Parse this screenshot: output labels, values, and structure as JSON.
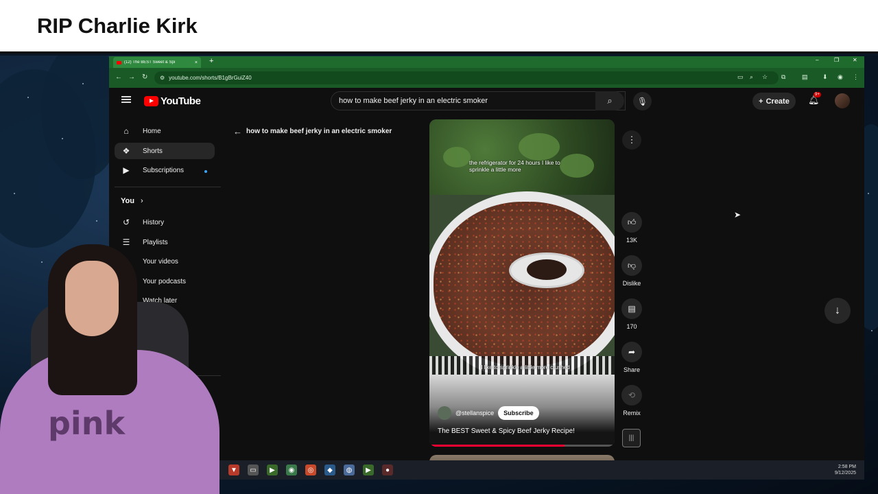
{
  "banner": {
    "title": "RIP Charlie Kirk"
  },
  "browser": {
    "tab_title": "(12) The BEST Sweet & Spi",
    "tab_close": "×",
    "new_tab": "+",
    "window_controls": [
      "–",
      "❐",
      "✕"
    ],
    "url": "youtube.com/shorts/B1gBrGuiZ40"
  },
  "youtube": {
    "logo_text": "YouTube",
    "search": {
      "value": "how to make beef jerky in an electric smoker",
      "clear": "✕"
    },
    "create_label": "Create",
    "notification_badge": "9+",
    "sidebar": {
      "items": [
        {
          "label": "Home",
          "icon": "home-icon"
        },
        {
          "label": "Shorts",
          "icon": "shorts-icon"
        },
        {
          "label": "Subscriptions",
          "icon": "subscriptions-icon"
        }
      ],
      "you_header": "You",
      "you_chevron": "›",
      "you_items": [
        {
          "label": "History",
          "icon": "history-icon"
        },
        {
          "label": "Playlists",
          "icon": "playlists-icon"
        },
        {
          "label": "Your videos",
          "icon": "your-videos-icon"
        },
        {
          "label": "Your podcasts",
          "icon": "podcasts-icon"
        },
        {
          "label": "Watch later",
          "icon": "watch-later-icon"
        }
      ]
    },
    "back_query": "how to make beef jerky in an electric smoker",
    "short": {
      "caption_top": "the refrigerator for 24 hours I like to sprinkle a little more",
      "caption_mid": "I like to sprinkle a little more crushed",
      "channel": "@stellanspice",
      "subscribe_label": "Subscribe",
      "title": "The BEST Sweet & Spicy Beef Jerky Recipe!",
      "progress": 0.73
    },
    "actions": {
      "likes": "13K",
      "dislike_label": "Dislike",
      "comments": "170",
      "share_label": "Share",
      "remix_label": "Remix"
    }
  },
  "taskbar": {
    "time": "2:58 PM",
    "date": "9/12/2025"
  },
  "webcam": {
    "shirt_text": "pink"
  },
  "colors": {
    "accent": "#ff0000",
    "tab_green": "#1f6b2d",
    "yt_bg": "#0f0f0f"
  }
}
